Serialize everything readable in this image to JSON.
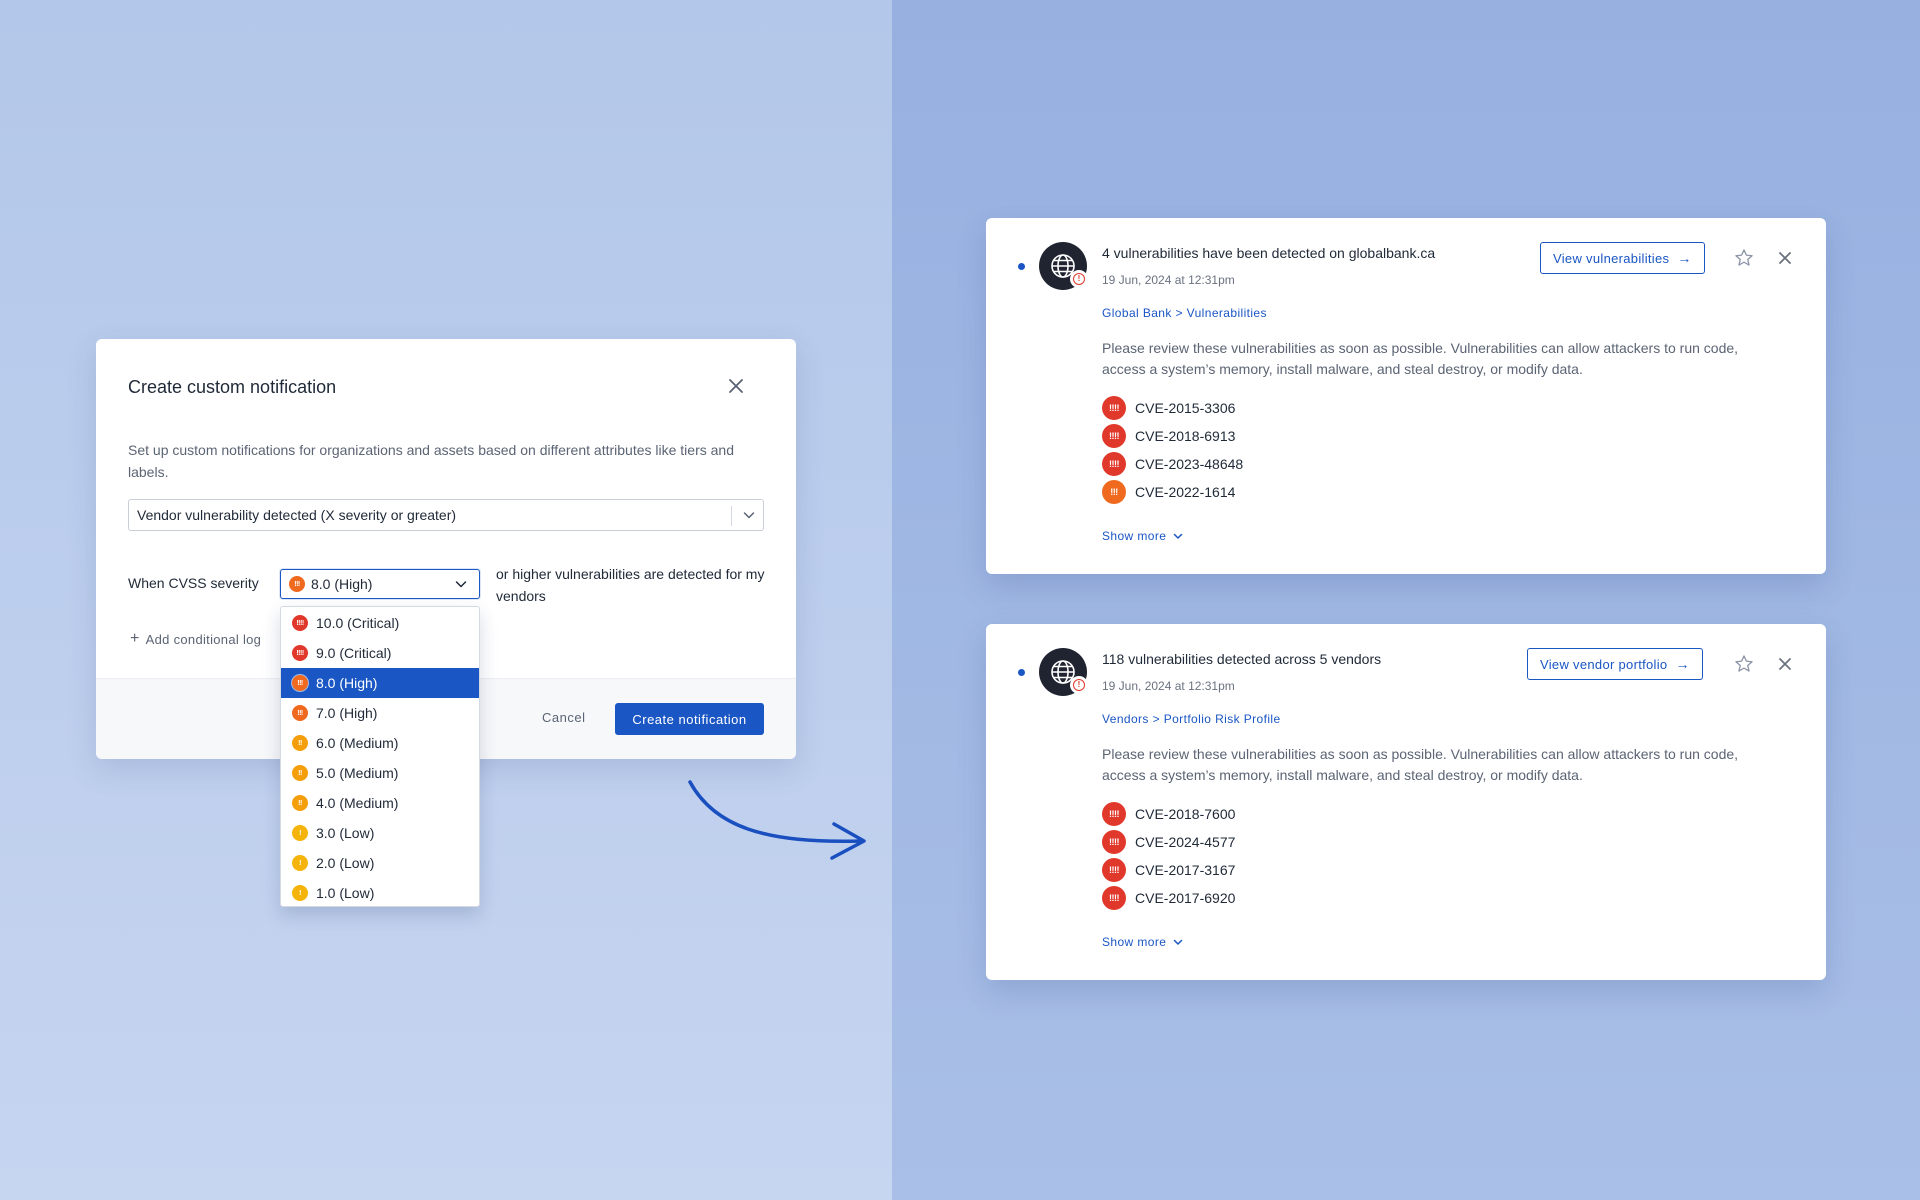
{
  "colors": {
    "accent": "#1a56c4",
    "critical": "#e0392b",
    "high": "#ef6a1f",
    "medium": "#f59e0b",
    "low": "#f5b40b"
  },
  "modal": {
    "title": "Create custom notification",
    "close_icon": "close-icon",
    "description": "Set up custom notifications for organizations and assets based on different attributes like tiers and labels.",
    "type_select_value": "Vendor vulnerability detected (X severity or greater)",
    "cvss_label": "When CVSS severity",
    "severity_value": "8.0 (High)",
    "severity_badge": "!!!",
    "cvss_suffix": "or higher vulnerabilities are detected for my vendors",
    "add_logic_label": "Add conditional log",
    "cancel_label": "Cancel",
    "create_label": "Create notification"
  },
  "dropdown": {
    "options": [
      {
        "label": "10.0 (Critical)",
        "level": "critical",
        "badge": "!!!!"
      },
      {
        "label": "9.0 (Critical)",
        "level": "critical",
        "badge": "!!!!"
      },
      {
        "label": "8.0 (High)",
        "level": "high",
        "badge": "!!!",
        "selected": true
      },
      {
        "label": "7.0 (High)",
        "level": "high",
        "badge": "!!!"
      },
      {
        "label": "6.0 (Medium)",
        "level": "medium",
        "badge": "!!"
      },
      {
        "label": "5.0 (Medium)",
        "level": "medium",
        "badge": "!!"
      },
      {
        "label": "4.0 (Medium)",
        "level": "medium",
        "badge": "!!"
      },
      {
        "label": "3.0 (Low)",
        "level": "low",
        "badge": "!"
      },
      {
        "label": "2.0 (Low)",
        "level": "low",
        "badge": "!"
      },
      {
        "label": "1.0 (Low)",
        "level": "low",
        "badge": "!"
      }
    ]
  },
  "notifications": [
    {
      "title": "4 vulnerabilities have been detected on globalbank.ca",
      "time": "19 Jun, 2024 at 12:31pm",
      "action_label": "View vulnerabilities",
      "breadcrumb": "Global Bank > Vulnerabilities",
      "body": "Please review these vulnerabilities as soon as possible. Vulnerabilities can allow attackers to run code, access a system’s memory, install malware, and steal destroy, or modify data.",
      "cves": [
        {
          "id": "CVE-2015-3306",
          "level": "critical",
          "badge": "!!!!"
        },
        {
          "id": "CVE-2018-6913",
          "level": "critical",
          "badge": "!!!!"
        },
        {
          "id": "CVE-2023-48648",
          "level": "critical",
          "badge": "!!!!"
        },
        {
          "id": "CVE-2022-1614",
          "level": "high",
          "badge": "!!!"
        }
      ],
      "show_more": "Show more"
    },
    {
      "title": "118 vulnerabilities detected across 5 vendors",
      "time": "19 Jun, 2024 at 12:31pm",
      "action_label": "View vendor portfolio",
      "breadcrumb": "Vendors > Portfolio Risk Profile",
      "body": "Please review these vulnerabilities as soon as possible. Vulnerabilities can allow attackers to run code, access a system’s memory, install malware, and steal destroy, or modify data.",
      "cves": [
        {
          "id": "CVE-2018-7600",
          "level": "critical",
          "badge": "!!!!"
        },
        {
          "id": "CVE-2024-4577",
          "level": "critical",
          "badge": "!!!!"
        },
        {
          "id": "CVE-2017-3167",
          "level": "critical",
          "badge": "!!!!"
        },
        {
          "id": "CVE-2017-6920",
          "level": "critical",
          "badge": "!!!!"
        }
      ],
      "show_more": "Show more"
    }
  ]
}
